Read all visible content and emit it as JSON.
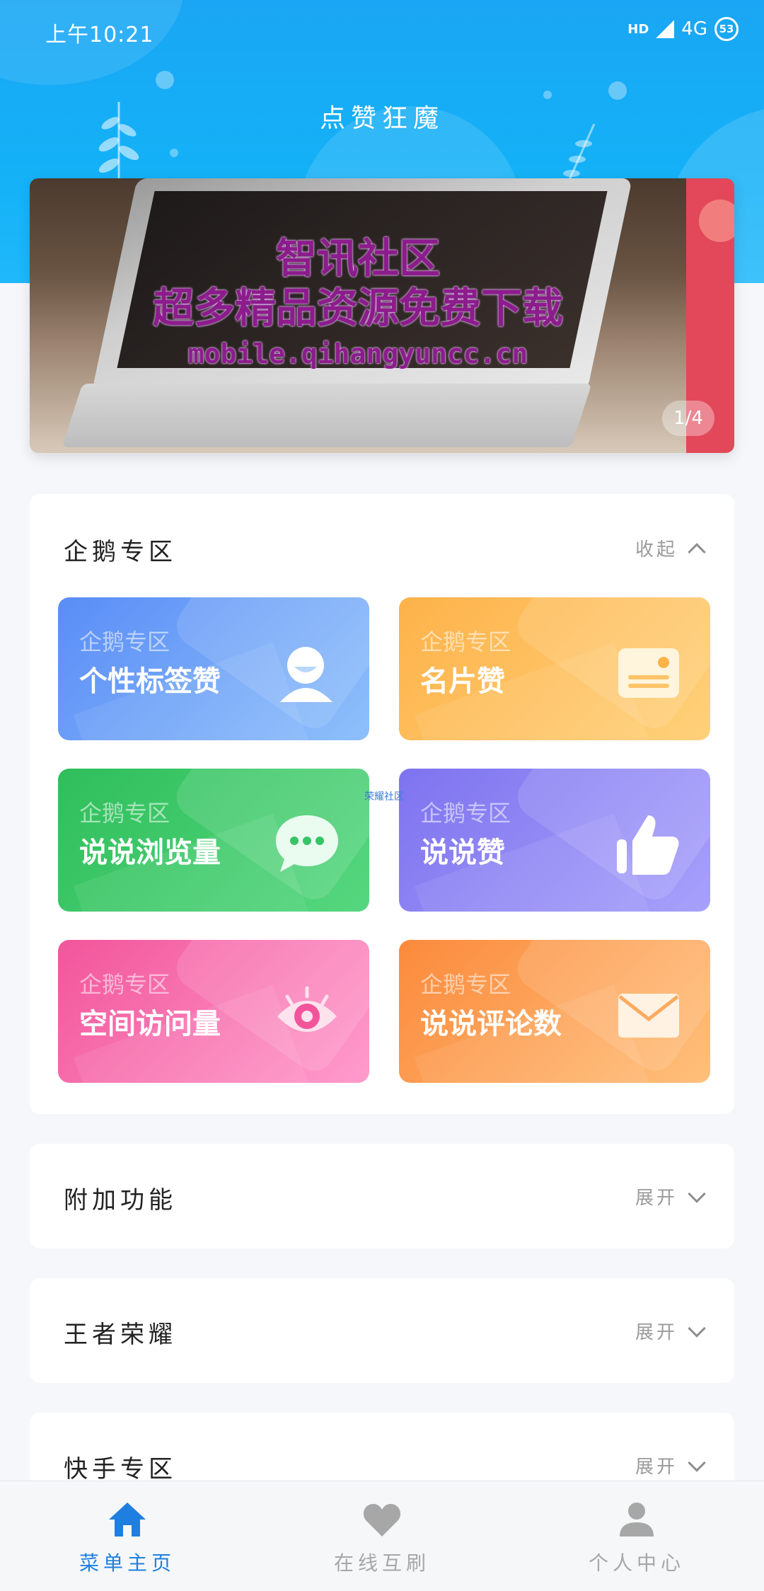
{
  "status_bar": {
    "time": "上午10:21",
    "network": "4G",
    "hd_label": "HD",
    "battery": "53"
  },
  "header": {
    "title": "点赞狂魔"
  },
  "banner": {
    "line1": "智讯社区",
    "line2": "超多精品资源免费下载",
    "line3": "mobile.qihangyuncc.cn",
    "pager": "1/4"
  },
  "sections": [
    {
      "title": "企鹅专区",
      "toggle": "收起",
      "expanded": true,
      "tiles": [
        {
          "sub": "企鹅专区",
          "label": "个性标签赞",
          "icon": "person-icon",
          "color": "#5a8df6"
        },
        {
          "sub": "企鹅专区",
          "label": "名片赞",
          "icon": "card-icon",
          "color": "#fdb24a"
        },
        {
          "sub": "企鹅专区",
          "label": "说说浏览量",
          "icon": "chat-bubble-icon",
          "color": "#2fbe5b"
        },
        {
          "sub": "企鹅专区",
          "label": "说说赞",
          "icon": "thumbs-up-icon",
          "color": "#7e73ef"
        },
        {
          "sub": "企鹅专区",
          "label": "空间访问量",
          "icon": "eye-icon",
          "color": "#f2559b"
        },
        {
          "sub": "企鹅专区",
          "label": "说说评论数",
          "icon": "envelope-icon",
          "color": "#fb8a3c"
        }
      ]
    },
    {
      "title": "附加功能",
      "toggle": "展开",
      "expanded": false
    },
    {
      "title": "王者荣耀",
      "toggle": "展开",
      "expanded": false
    },
    {
      "title": "快手专区",
      "toggle": "展开",
      "expanded": false
    }
  ],
  "watermark": "荣耀社区",
  "tabbar": {
    "items": [
      {
        "label": "菜单主页",
        "icon": "home-icon",
        "active": true
      },
      {
        "label": "在线互刷",
        "icon": "heart-icon",
        "active": false
      },
      {
        "label": "个人中心",
        "icon": "user-icon",
        "active": false
      }
    ],
    "active_color": "#1e7fe0",
    "inactive_color": "#a7a7a7"
  }
}
